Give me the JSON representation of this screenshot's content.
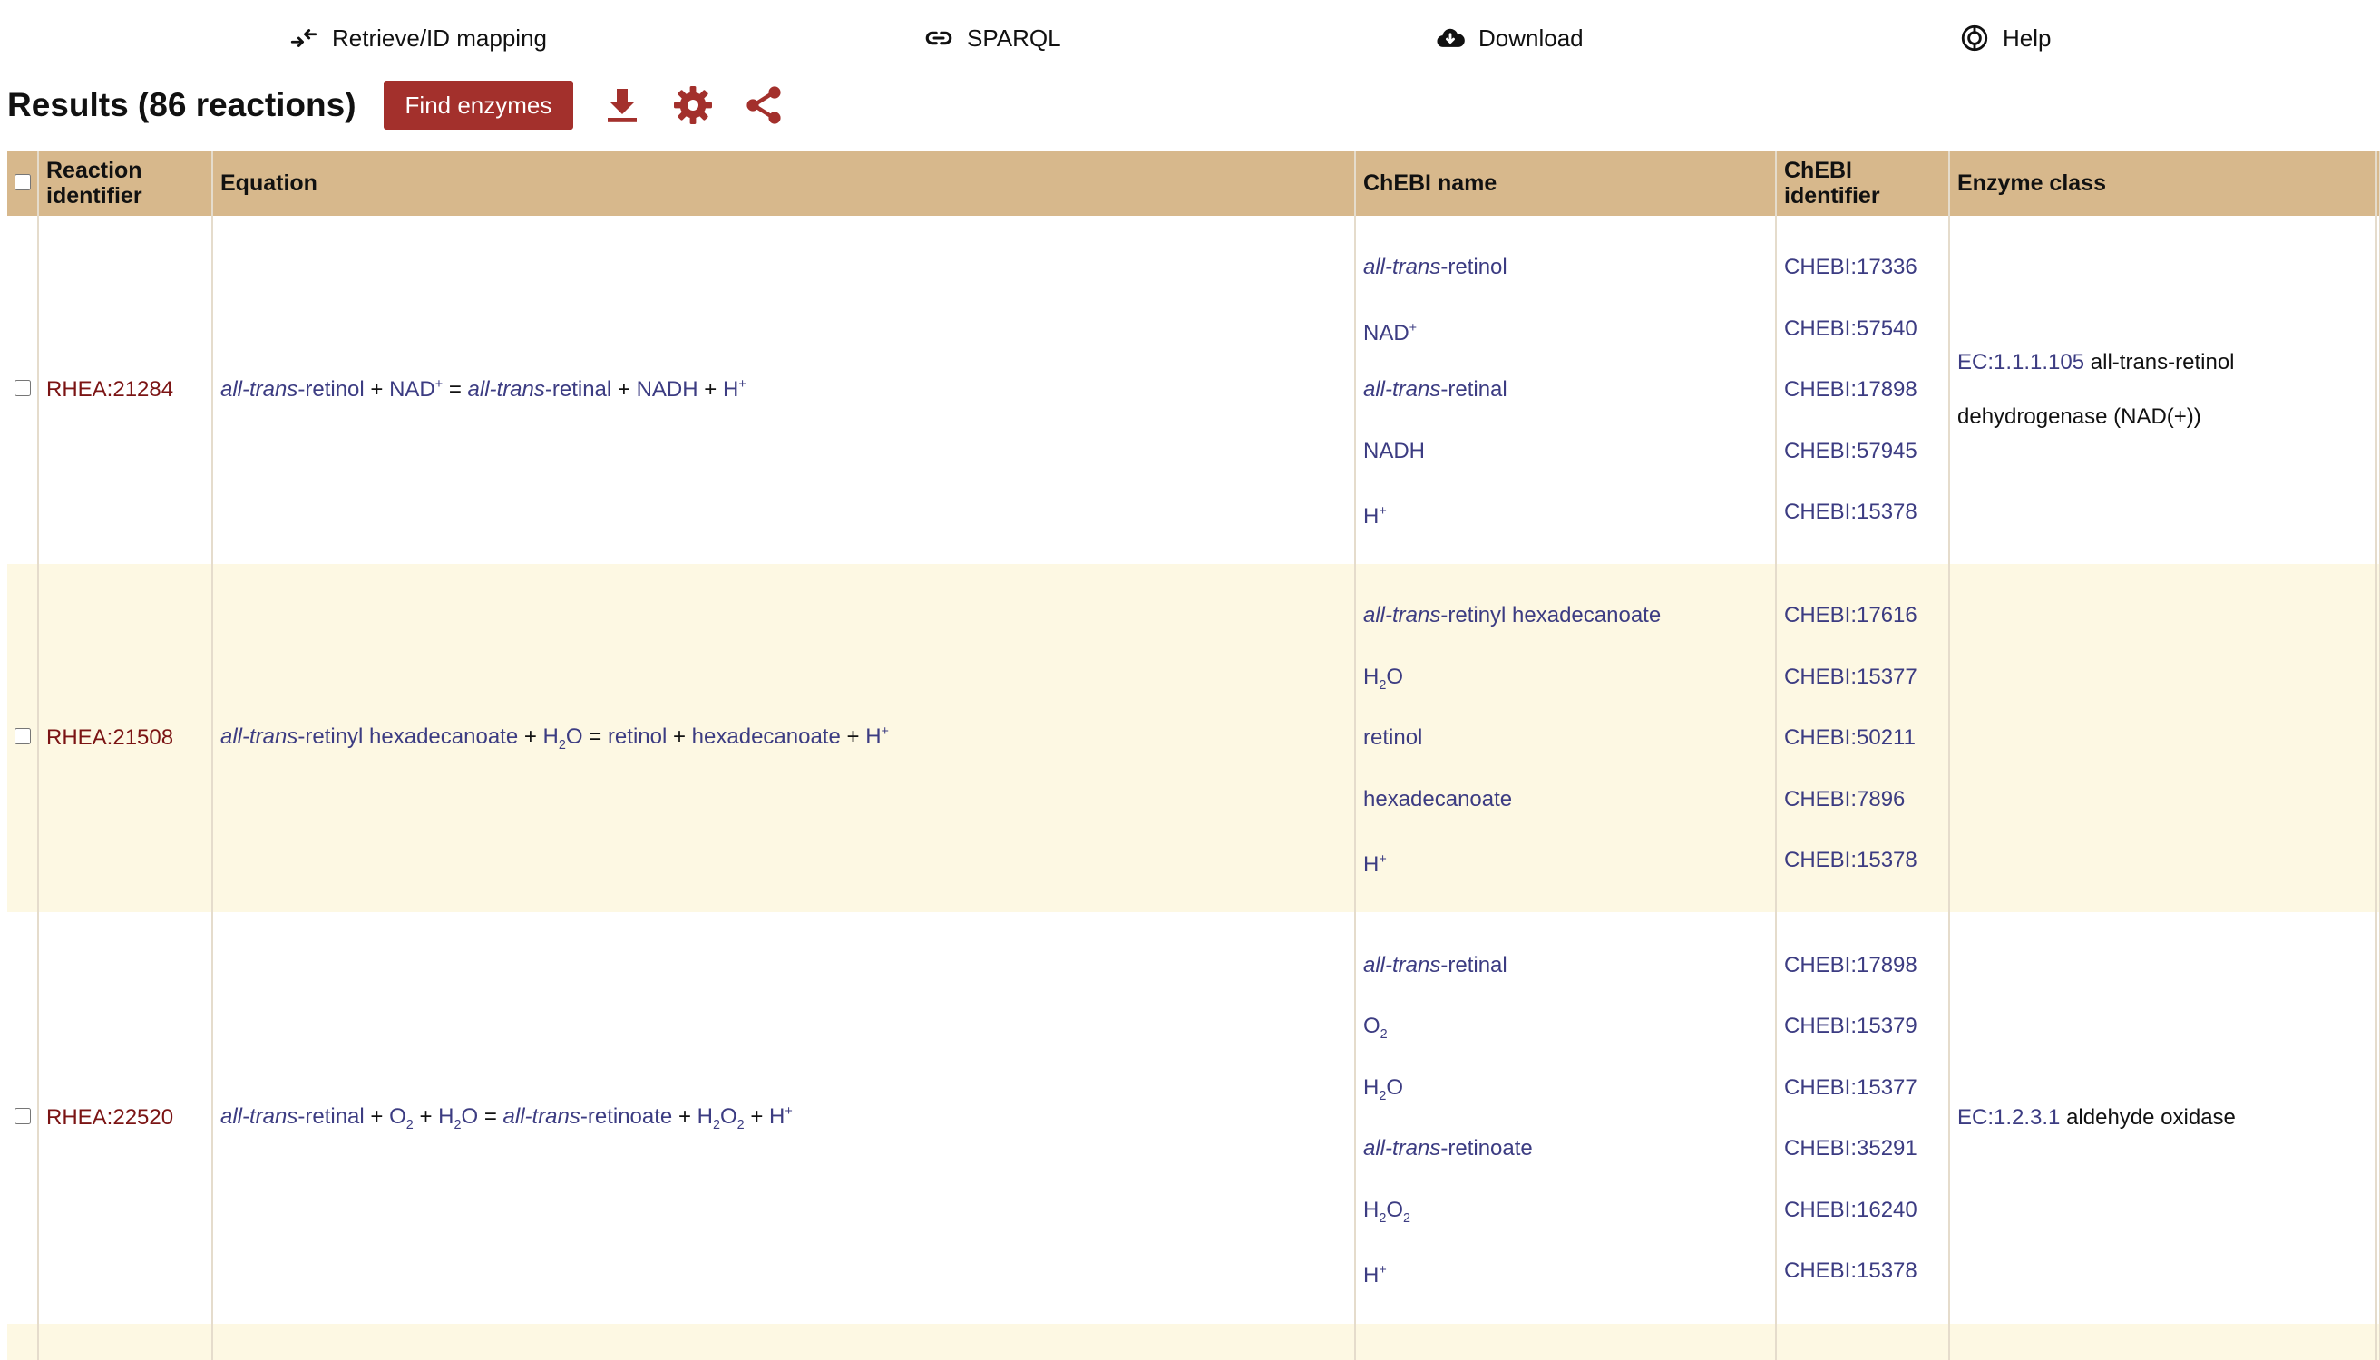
{
  "nav": {
    "retrieve": "Retrieve/ID mapping",
    "sparql": "SPARQL",
    "download": "Download",
    "help": "Help"
  },
  "results": {
    "title": "Results (86 reactions)",
    "find_enzymes": "Find enzymes"
  },
  "colors": {
    "accent": "#a3302c",
    "header_bg": "#d7b88c",
    "alt_row_bg": "#fdf8e3",
    "link": "#3c3c82",
    "rhea_link": "#7b1414"
  },
  "table": {
    "headers": {
      "reaction_id": "Reaction identifier",
      "equation": "Equation",
      "chebi_name": "ChEBI name",
      "chebi_id": "ChEBI identifier",
      "enzyme_class": "Enzyme class"
    },
    "rows": [
      {
        "rhea": "RHEA:21284",
        "equation": {
          "p1": "all-trans",
          "p2": "-retinol",
          "p3": "NAD",
          "p4": "+",
          "p5": "all-trans",
          "p6": "-retinal",
          "p7": "NADH",
          "p8": "H",
          "p9": "+",
          "plus": "+",
          "eq": "="
        },
        "chebi_names": {
          "n1a": "all-trans",
          "n1b": "-retinol",
          "n2a": "NAD",
          "n2b": "+",
          "n3a": "all-trans",
          "n3b": "-retinal",
          "n4": "NADH",
          "n5a": "H",
          "n5b": "+"
        },
        "chebi_ids": [
          "CHEBI:17336",
          "CHEBI:57540",
          "CHEBI:17898",
          "CHEBI:57945",
          "CHEBI:15378"
        ],
        "enzyme": {
          "ec": "EC:1.1.1.105",
          "name": "all-trans-retinol dehydrogenase (NAD(+))"
        }
      },
      {
        "rhea": "RHEA:21508",
        "equation": {
          "p1": "all-trans",
          "p2": "-retinyl hexadecanoate",
          "p3": "H",
          "p4": "2",
          "p5": "O",
          "p6": "retinol",
          "p7": "hexadecanoate",
          "p8": "H",
          "p9": "+",
          "plus": "+",
          "eq": "="
        },
        "chebi_names": {
          "n1a": "all-trans",
          "n1b": "-retinyl hexadecanoate",
          "n2a": "H",
          "n2b": "2",
          "n2c": "O",
          "n3": "retinol",
          "n4": "hexadecanoate",
          "n5a": "H",
          "n5b": "+"
        },
        "chebi_ids": [
          "CHEBI:17616",
          "CHEBI:15377",
          "CHEBI:50211",
          "CHEBI:7896",
          "CHEBI:15378"
        ]
      },
      {
        "rhea": "RHEA:22520",
        "equation": {
          "p1": "all-trans",
          "p2": "-retinal",
          "p3": "O",
          "p4": "2",
          "p5": "H",
          "p6": "2",
          "p7": "O",
          "p8": "all-trans",
          "p9": "-retinoate",
          "p10": "H",
          "p11": "2",
          "p12": "O",
          "p13": "2",
          "p14": "H",
          "p15": "+",
          "plus": "+",
          "eq": "="
        },
        "chebi_names": {
          "n1a": "all-trans",
          "n1b": "-retinal",
          "n2a": "O",
          "n2b": "2",
          "n3a": "H",
          "n3b": "2",
          "n3c": "O",
          "n4a": "all-trans",
          "n4b": "-retinoate",
          "n5a": "H",
          "n5b": "2",
          "n5c": "O",
          "n5d": "2",
          "n6a": "H",
          "n6b": "+"
        },
        "chebi_ids": [
          "CHEBI:17898",
          "CHEBI:15379",
          "CHEBI:15377",
          "CHEBI:35291",
          "CHEBI:16240",
          "CHEBI:15378"
        ],
        "enzyme": {
          "ec": "EC:1.2.3.1",
          "name": "aldehyde oxidase"
        }
      }
    ]
  }
}
